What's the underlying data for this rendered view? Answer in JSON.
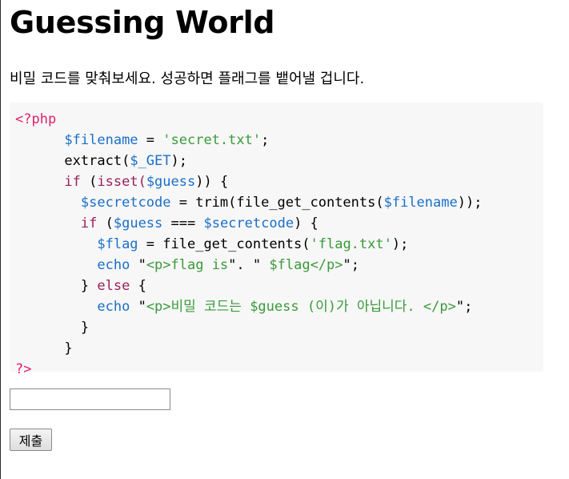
{
  "page": {
    "title": "Guessing World",
    "intro": "비밀 코드를 맞춰보세요. 성공하면 플래그를 뱉어낼 겁니다."
  },
  "code": {
    "open_tag": "<?php",
    "line1": {
      "var": "$filename",
      "eq": " = ",
      "str": "'secret.txt'",
      "end": ";"
    },
    "line2": {
      "fn": "extract(",
      "var": "$_GET",
      "end": ");"
    },
    "line3": {
      "kw": "if",
      "p1": " (",
      "fn": "isset(",
      "var": "$guess",
      "end": ")) {"
    },
    "line4": {
      "var": "$secretcode",
      "eq": " = ",
      "fn": "trim(file_get_contents(",
      "var2": "$filename",
      "end": "));"
    },
    "line5": {
      "kw": "if",
      "p1": " (",
      "var": "$guess",
      "op": " === ",
      "var2": "$secretcode",
      "end": ") {"
    },
    "line6": {
      "var": "$flag",
      "eq": " = ",
      "fn": "file_get_contents(",
      "str": "'flag.txt'",
      "end": ");"
    },
    "line7": {
      "kw": "echo",
      "sp": " ",
      "q1": "\"",
      "str": "<p>flag is",
      "q2": "\"",
      "dot": ".",
      "q3": " \"",
      "var": " $flag</p>",
      "q4": "\"",
      "end": ";"
    },
    "line8": {
      "text": "} ",
      "kw": "else",
      "end": " {"
    },
    "line9": {
      "kw": "echo",
      "sp": " ",
      "q1": "\"",
      "str": "<p>비밀 코드는 ",
      "var": "$guess",
      "str2": " (이)가 아닙니다. </p>",
      "q2": "\"",
      "end": ";"
    },
    "line10": {
      "text": "}"
    },
    "line11": {
      "text": "}"
    },
    "close_tag": "?>"
  },
  "form": {
    "guess_value": "",
    "submit_label": "제출"
  }
}
